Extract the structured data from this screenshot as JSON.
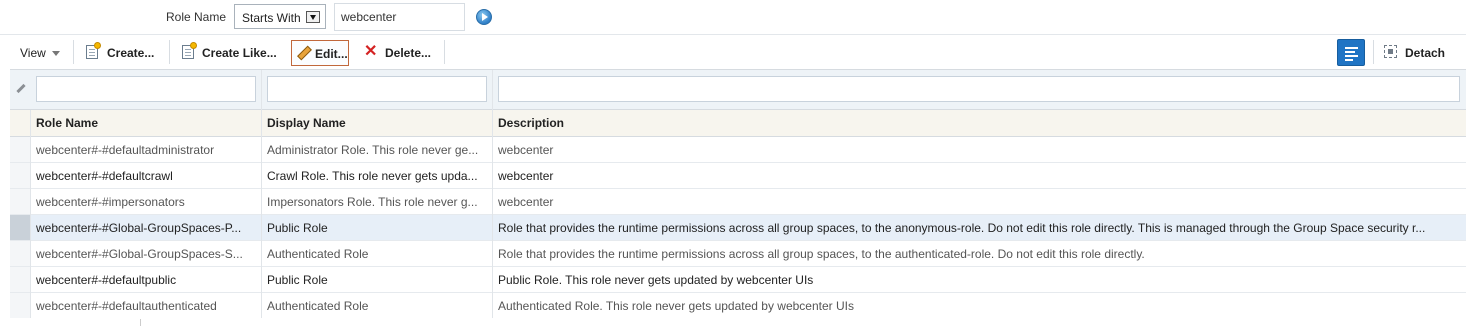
{
  "search": {
    "label": "Role Name",
    "operator": "Starts With",
    "value": "webcenter"
  },
  "toolbar": {
    "view_label": "View",
    "create_label": "Create...",
    "create_like_label": "Create Like...",
    "edit_label": "Edit...",
    "delete_label": "Delete...",
    "detach_label": "Detach"
  },
  "table": {
    "columns": [
      "Role Name",
      "Display Name",
      "Description"
    ],
    "rows": [
      {
        "role": "webcenter#-#defaultadministrator",
        "display": "Administrator Role. This role never ge...",
        "description": "webcenter"
      },
      {
        "role": "webcenter#-#defaultcrawl",
        "display": "Crawl Role. This role never gets upda...",
        "description": "webcenter"
      },
      {
        "role": "webcenter#-#impersonators",
        "display": "Impersonators Role. This role never g...",
        "description": "webcenter"
      },
      {
        "role": "webcenter#-#Global-GroupSpaces-P...",
        "display": "Public Role",
        "description": "Role that provides the runtime permissions across all group spaces, to the anonymous-role. Do not edit this role directly. This is managed through the Group Space security r..."
      },
      {
        "role": "webcenter#-#Global-GroupSpaces-S...",
        "display": "Authenticated Role",
        "description": "Role that provides the runtime permissions across all group spaces, to the authenticated-role. Do not edit this role directly."
      },
      {
        "role": "webcenter#-#defaultpublic",
        "display": "Public Role",
        "description": "Public Role. This role never gets updated by webcenter UIs"
      },
      {
        "role": "webcenter#-#defaultauthenticated",
        "display": "Authenticated Role",
        "description": "Authenticated Role. This role never gets updated by webcenter UIs"
      }
    ],
    "selected_row": 3
  },
  "icons": {
    "go": "go-arrow-icon",
    "create": "create-doc-icon",
    "create_like": "create-like-doc-icon",
    "edit": "pencil-icon",
    "delete": "red-x-icon",
    "layout": "column-layout-icon",
    "detach": "detach-icon",
    "filter": "filter-pencil-icon"
  },
  "colors": {
    "accent": "#1f74c4",
    "selected_row": "#e7eff8",
    "header_bg": "#f7f5ee",
    "filter_bg": "#eef3f7",
    "delete": "#d42222"
  }
}
